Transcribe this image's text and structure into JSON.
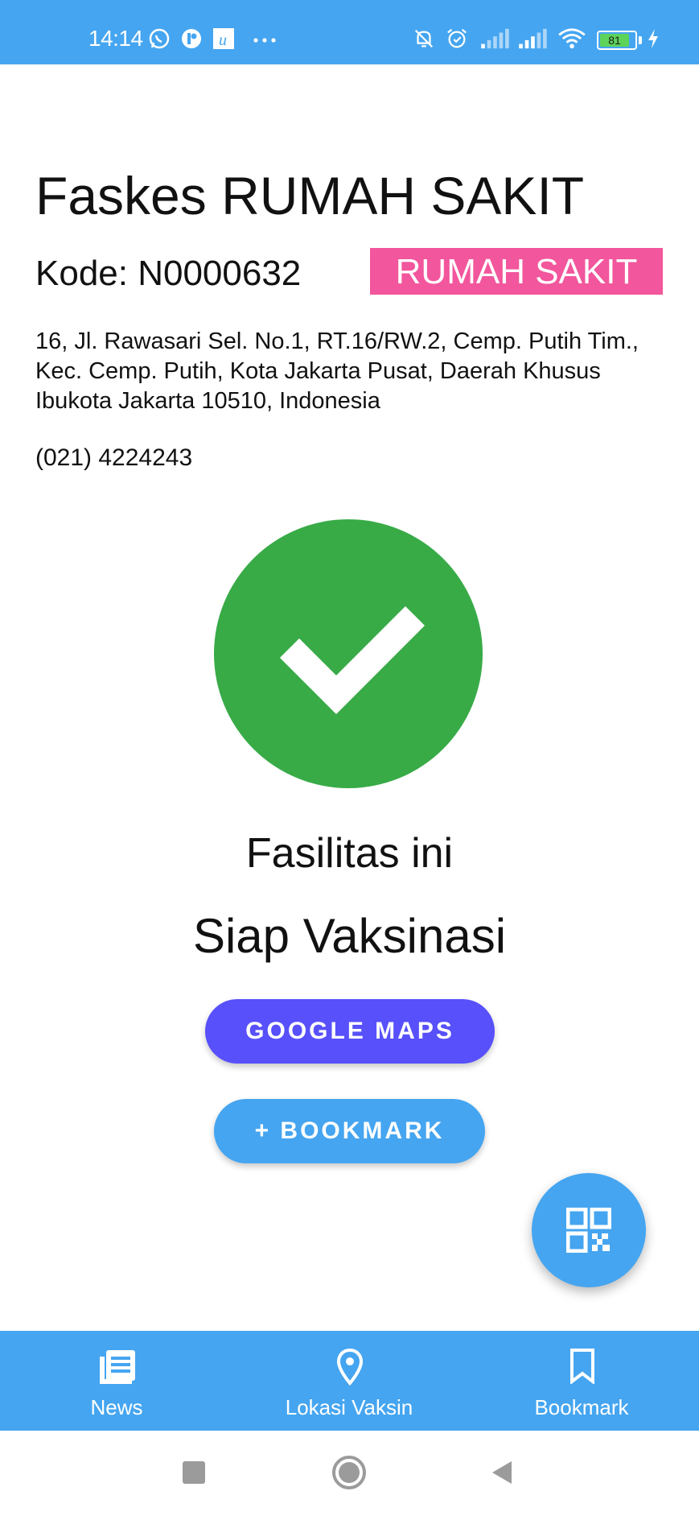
{
  "status_bar": {
    "time": "14:14",
    "battery_level": "81",
    "icons": [
      "whatsapp-icon",
      "app-notification-icon",
      "u-app-icon",
      "more-dots-icon",
      "mute-bell-icon",
      "alarm-icon",
      "signal-icon",
      "signal-icon",
      "wifi-icon",
      "battery-icon",
      "charging-icon"
    ]
  },
  "facility": {
    "title": "Faskes RUMAH SAKIT",
    "code": "Kode: N0000632",
    "type_badge": "RUMAH SAKIT",
    "address": "16, Jl. Rawasari Sel. No.1, RT.16/RW.2, Cemp. Putih Tim., Kec. Cemp. Putih, Kota Jakarta Pusat, Daerah Khusus Ibukota Jakarta 10510, Indonesia",
    "phone": "(021) 4224243"
  },
  "status": {
    "line1": "Fasilitas ini",
    "line2": "Siap Vaksinasi",
    "icon": "check-icon"
  },
  "actions": {
    "maps_label": "GOOGLE MAPS",
    "bookmark_label": "+ BOOKMARK",
    "fab_icon": "qr-code-icon"
  },
  "bottom_nav": {
    "items": [
      {
        "label": "News",
        "icon": "news-icon"
      },
      {
        "label": "Lokasi Vaksin",
        "icon": "location-pin-icon"
      },
      {
        "label": "Bookmark",
        "icon": "bookmark-icon"
      }
    ]
  },
  "colors": {
    "primary": "#45a5f0",
    "badge": "#f2569c",
    "maps_button": "#5750fb",
    "success": "#38ab47"
  }
}
